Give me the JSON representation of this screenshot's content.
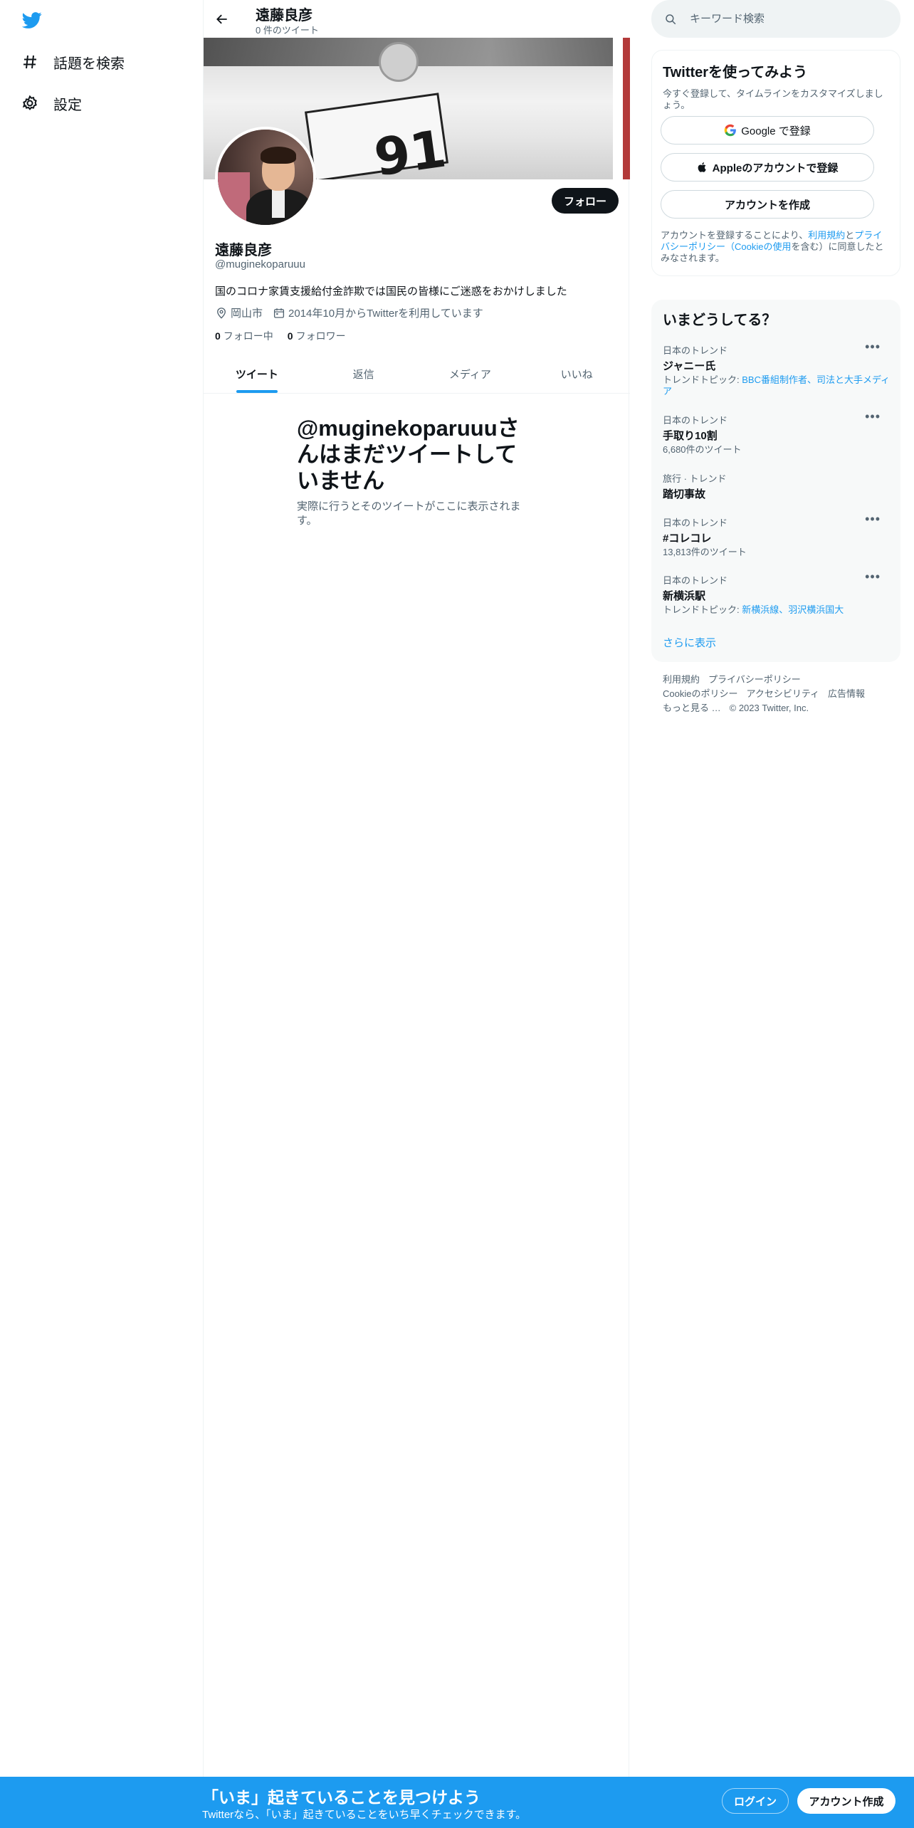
{
  "nav": {
    "items": [
      {
        "label": "話題を検索",
        "icon": "hashtag-icon"
      },
      {
        "label": "設定",
        "icon": "gear-icon"
      }
    ]
  },
  "header": {
    "title": "遠藤良彦",
    "subtitle": "0 件のツイート"
  },
  "profile": {
    "name": "遠藤良彦",
    "handle": "@muginekoparuuu",
    "bio": "国のコロナ家賃支援給付金詐欺では国民の皆様にご迷惑をおかけしました",
    "location": "岡山市",
    "joined": "2014年10月からTwitterを利用しています",
    "following_count": "0",
    "following_label": "フォロー中",
    "followers_count": "0",
    "followers_label": "フォロワー",
    "follow_button": "フォロー",
    "banner_plate_text": "91"
  },
  "tabs": [
    "ツイート",
    "返信",
    "メディア",
    "いいね"
  ],
  "empty_state": {
    "title": "@muginekoparuuuさんはまだツイートしていません",
    "body": "実際に行うとそのツイートがここに表示されます。"
  },
  "search": {
    "placeholder": "キーワード検索"
  },
  "signup_card": {
    "title": "Twitterを使ってみよう",
    "subtitle": "今すぐ登録して、タイムラインをカスタマイズしましょう。",
    "google_button": "Google で登録",
    "apple_button": "Appleのアカウントで登録",
    "create_button": "アカウントを作成",
    "legal_prefix": "アカウントを登録することにより、",
    "legal_terms": "利用規約",
    "legal_and": "と",
    "legal_privacy": "プライバシーポリシー（Cookieの使用",
    "legal_suffix": "を含む）に同意したとみなされます。"
  },
  "trends": {
    "title": "いまどうしてる？",
    "items": [
      {
        "context": "日本のトレンド",
        "title": "ジャニー氏",
        "extra_prefix": "トレンドトピック: ",
        "extra_link": "BBC番組制作者、司法と大手メディア"
      },
      {
        "context": "日本のトレンド",
        "title": "手取り10割",
        "extra_prefix": "6,680件のツイート",
        "extra_link": ""
      },
      {
        "context": "旅行 · トレンド",
        "title": "踏切事故",
        "extra_prefix": "",
        "extra_link": ""
      },
      {
        "context": "日本のトレンド",
        "title": "#コレコレ",
        "extra_prefix": "13,813件のツイート",
        "extra_link": ""
      },
      {
        "context": "日本のトレンド",
        "title": "新横浜駅",
        "extra_prefix": "トレンドトピック: ",
        "extra_link": "新横浜線、羽沢横浜国大"
      }
    ],
    "more_icon": "•••",
    "show_more": "さらに表示"
  },
  "footer": {
    "links": [
      "利用規約",
      "プライバシーポリシー",
      "Cookieのポリシー",
      "アクセシビリティ",
      "広告情報",
      "もっと見る …",
      "© 2023 Twitter, Inc."
    ]
  },
  "bottom_bar": {
    "title": "「いま」起きていることを見つけよう",
    "subtitle": "Twitterなら、「いま」起きていることをいち早くチェックできます。",
    "login": "ログイン",
    "signup": "アカウント作成"
  },
  "colors": {
    "accent": "#1d9bf0",
    "text": "#0f1419",
    "muted": "#536471",
    "border": "#eff3f4"
  }
}
